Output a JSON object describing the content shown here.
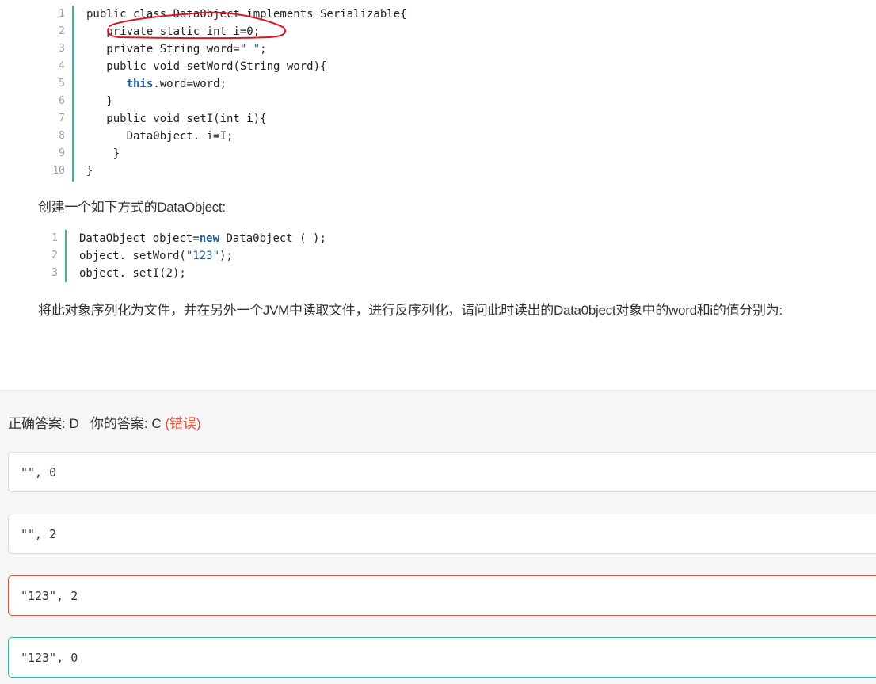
{
  "code_block_1": {
    "line_numbers": [
      "1",
      "2",
      "3",
      "4",
      "5",
      "6",
      "7",
      "8",
      "9",
      "10"
    ],
    "lines": [
      {
        "text": "public class DataObject implements Serializable{"
      },
      {
        "text": "   private static int i=0;"
      },
      {
        "text": "   private String word=",
        "str": "\" \"",
        "tail": ";"
      },
      {
        "text": "   public void setWord(String word){"
      },
      {
        "kw": "this",
        "kw_indent": "      ",
        "text": ".word=word;"
      },
      {
        "text": "   }"
      },
      {
        "text": "   public void setI(int i){"
      },
      {
        "text": "      Data0bject. i=I;"
      },
      {
        "text": "    }"
      },
      {
        "text": "}"
      }
    ]
  },
  "paragraph_1": "创建一个如下方式的DataObject:",
  "code_block_2": {
    "line_numbers": [
      "1",
      "2",
      "3"
    ],
    "lines": [
      {
        "text": "DataObject object=",
        "kw": "new",
        "tail": " Data0bject ( );"
      },
      {
        "text": "object. setWord(",
        "str": "\"123\"",
        "tail": ");"
      },
      {
        "text": "object. setI(2);"
      }
    ]
  },
  "paragraph_2": "将此对象序列化为文件，并在另外一个JVM中读取文件，进行反序列化，请问此时读出的Data0bject对象中的word和i的值分别为:",
  "answer": {
    "correct_label": "正确答案: D",
    "yours_label": "你的答案: C",
    "wrong_tag": "(错误)"
  },
  "options": [
    {
      "text": "\"\", 0",
      "state": "normal"
    },
    {
      "text": "\"\", 2",
      "state": "normal"
    },
    {
      "text": "\"123\", 2",
      "state": "wrong"
    },
    {
      "text": "\"123\", 0",
      "state": "correct"
    }
  ],
  "colors": {
    "accent_green": "#3bb49b",
    "error_red": "#e0553c",
    "keyword_blue": "#1d5c9e",
    "annotation_red": "#e0141e"
  }
}
